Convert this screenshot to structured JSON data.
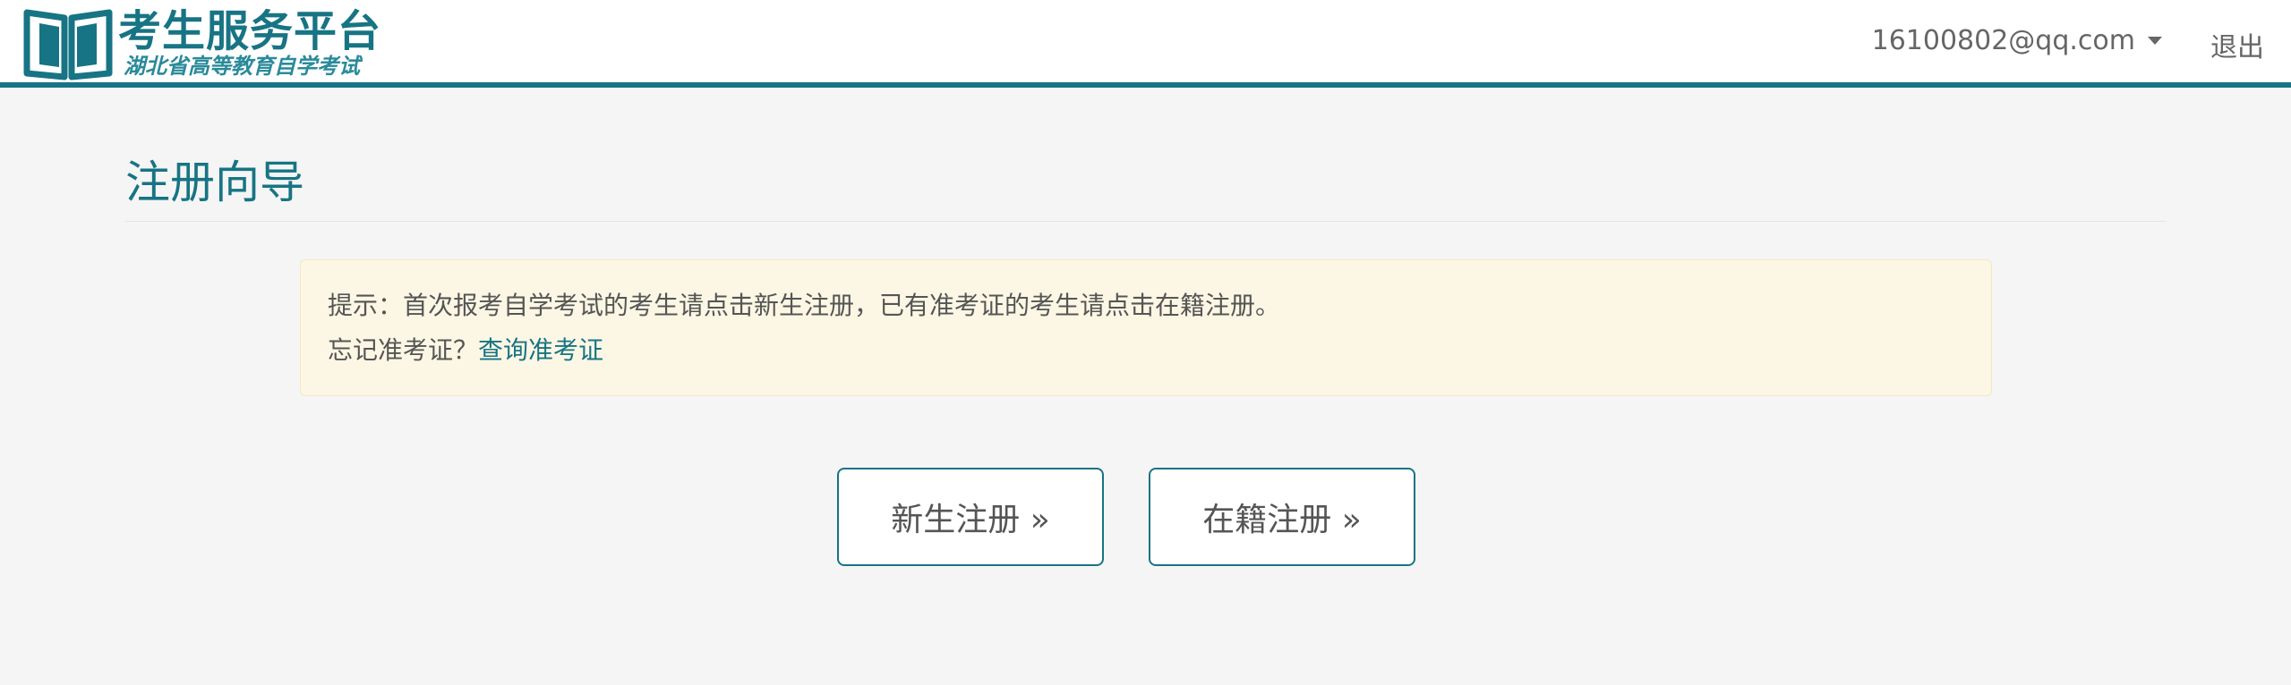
{
  "header": {
    "logo_title": "考生服务平台",
    "logo_subtitle": "湖北省高等教育自学考试",
    "logo_icon": "open-book-icon",
    "user_email": "16100802@qq.com",
    "logout_label": "退出",
    "accent_color": "#177484"
  },
  "page": {
    "title": "注册向导"
  },
  "notice": {
    "line1": "提示：首次报考自学考试的考生请点击新生注册，已有准考证的考生请点击在籍注册。",
    "line2_prefix": "忘记准考证？",
    "line2_link": "查询准考证"
  },
  "actions": {
    "new_student_label": "新生注册 »",
    "enrolled_student_label": "在籍注册 »"
  }
}
